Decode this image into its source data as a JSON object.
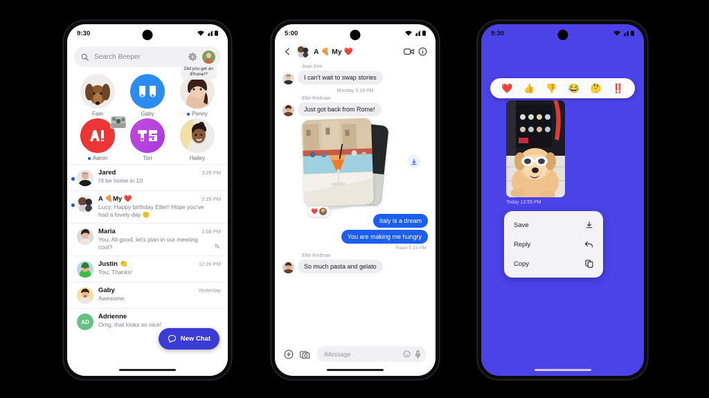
{
  "phone1": {
    "status": {
      "time": "9:30",
      "icons": [
        "wifi-icon",
        "signal-icon",
        "battery-icon"
      ]
    },
    "search": {
      "placeholder": "Search Beeper",
      "icon": "search-icon",
      "settings_icon": "gear-icon",
      "avatar": "profile-avatar"
    },
    "stories": [
      {
        "name": "Fam",
        "unread": false,
        "bubble": null,
        "badge": false
      },
      {
        "name": "Gaby",
        "unread": false,
        "bubble": null,
        "badge": false
      },
      {
        "name": "Penny",
        "unread": true,
        "bubble": "Did you get an iPhone!?",
        "badge": false
      },
      {
        "name": "Aaron",
        "unread": true,
        "bubble": null,
        "badge": true
      },
      {
        "name": "Tori",
        "unread": false,
        "bubble": null,
        "badge": false
      },
      {
        "name": "Hailey",
        "unread": false,
        "bubble": null,
        "badge": false
      }
    ],
    "chats": [
      {
        "name": "Jared",
        "time": "3:25 PM",
        "preview": "I'll be home in 10",
        "unread": true,
        "muted": false
      },
      {
        "name": "A 🍕My ❤️",
        "time": "2:29 PM",
        "preview": "Lucy: Happy birthday Ellie!! Hope you've had a lovely day  🙂",
        "unread": true,
        "muted": false
      },
      {
        "name": "Maria",
        "time": "1:08 PM",
        "preview": "You: All good, let's plan in our meeting cool?",
        "unread": false,
        "muted": true
      },
      {
        "name": "Justin 👏",
        "time": "12:26 PM",
        "preview": "You: Thanks!",
        "unread": false,
        "muted": false
      },
      {
        "name": "Gaby",
        "time": "Yesterday",
        "preview": "Awesome.",
        "unread": false,
        "muted": false
      },
      {
        "name": "Adrienne",
        "time": "",
        "preview": "Omg, that looks so nice!",
        "unread": false,
        "muted": false,
        "initials": "AD"
      }
    ],
    "fab": {
      "label": "New Chat",
      "icon": "chat-bubble-icon",
      "color": "#3b3bd6"
    }
  },
  "phone2": {
    "status": {
      "time": "5:00"
    },
    "header": {
      "back_icon": "back-arrow-icon",
      "title": "A 🍕 My ❤️",
      "video_icon": "video-call-icon",
      "info_icon": "info-icon"
    },
    "messages": [
      {
        "type": "sender-label",
        "text": "Jean Kim"
      },
      {
        "type": "incoming",
        "text": "I can't wait to swap stories"
      },
      {
        "type": "daystamp",
        "text": "Monday 5:18 PM"
      },
      {
        "type": "sender-label",
        "text": "Ellie Redman"
      },
      {
        "type": "incoming",
        "text": "Just got back from Rome!"
      },
      {
        "type": "photo-stack",
        "reaction": "❤️",
        "download_icon": "download-icon"
      },
      {
        "type": "outgoing",
        "text": "Italy is a dream"
      },
      {
        "type": "outgoing",
        "text": "You are making me hungry"
      },
      {
        "type": "readmark",
        "text": "Read  5:23 PM"
      },
      {
        "type": "sender-label",
        "text": "Ellie Redman"
      },
      {
        "type": "incoming",
        "text": "So much pasta and gelato"
      }
    ],
    "composer": {
      "plus_icon": "add-attachment-icon",
      "gallery_icon": "photo-camera-icon",
      "placeholder": "iMessage",
      "emoji_icon": "emoji-icon",
      "mic_icon": "microphone-icon"
    }
  },
  "phone3": {
    "status": {
      "time": "9:30"
    },
    "background_color": "#4b42e8",
    "reactions": [
      "❤️",
      "👍",
      "👎",
      "😂",
      "🤔",
      "‼️"
    ],
    "photo_caption": "Today  12:55 PM",
    "menu": [
      {
        "label": "Save",
        "icon": "download-icon"
      },
      {
        "label": "Reply",
        "icon": "reply-arrow-icon"
      },
      {
        "label": "Copy",
        "icon": "copy-icon"
      }
    ]
  }
}
